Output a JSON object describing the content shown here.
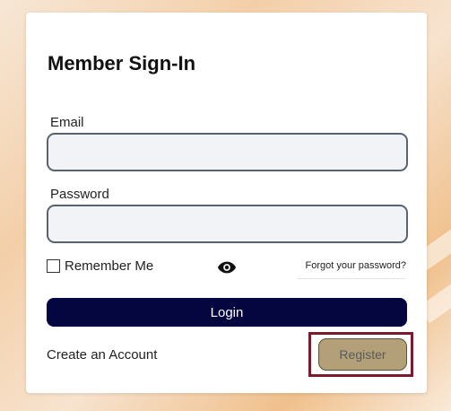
{
  "form": {
    "title": "Member Sign-In",
    "email_label": "Email",
    "email_value": "",
    "password_label": "Password",
    "password_value": "",
    "remember_label": "Remember Me",
    "remember_checked": false,
    "show_password_icon": "eye-icon",
    "forgot_label": "Forgot your password?",
    "login_label": "Login",
    "create_account_label": "Create an Account",
    "register_label": "Register"
  },
  "colors": {
    "login_bg": "#050540",
    "register_bg": "#b3a079",
    "highlight_outline": "#7a1a2a"
  }
}
